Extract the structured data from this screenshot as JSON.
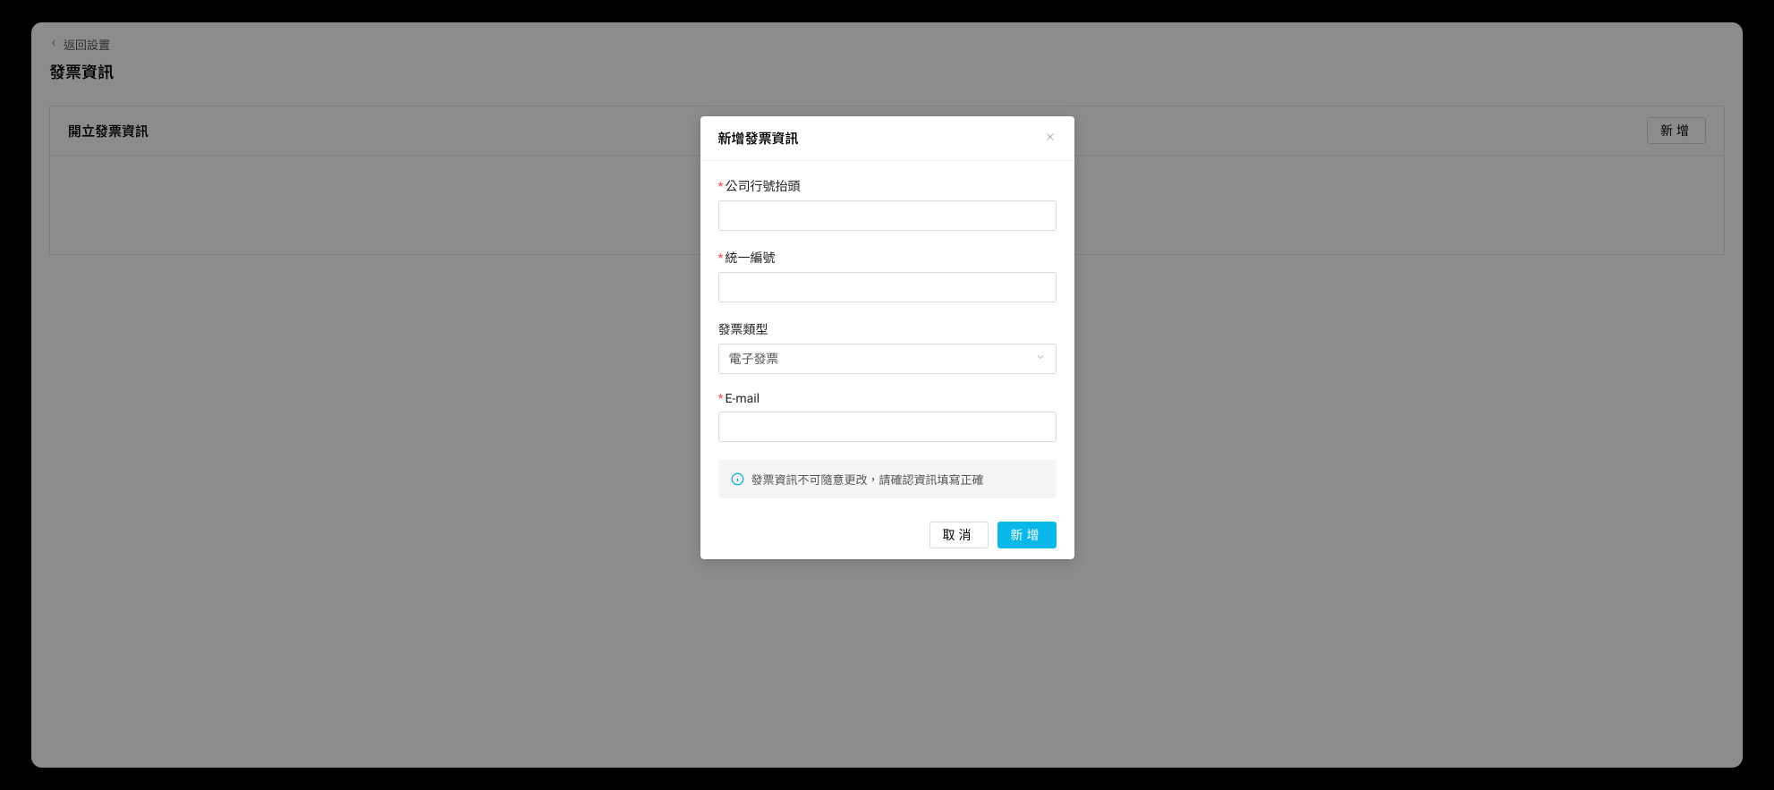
{
  "header": {
    "back_label": "返回設置",
    "page_title": "發票資訊"
  },
  "section": {
    "title": "開立發票資訊",
    "add_label": "新增"
  },
  "modal": {
    "title": "新增發票資訊",
    "field_company_label": "公司行號抬頭",
    "field_company_value": "",
    "field_taxid_label": "統一編號",
    "field_taxid_value": "",
    "field_type_label": "發票類型",
    "field_type_selected": "電子發票",
    "field_email_label": "E-mail",
    "field_email_value": "",
    "alert_text": "發票資訊不可隨意更改，請確認資訊填寫正確",
    "cancel_label": "取消",
    "submit_label": "新增"
  }
}
